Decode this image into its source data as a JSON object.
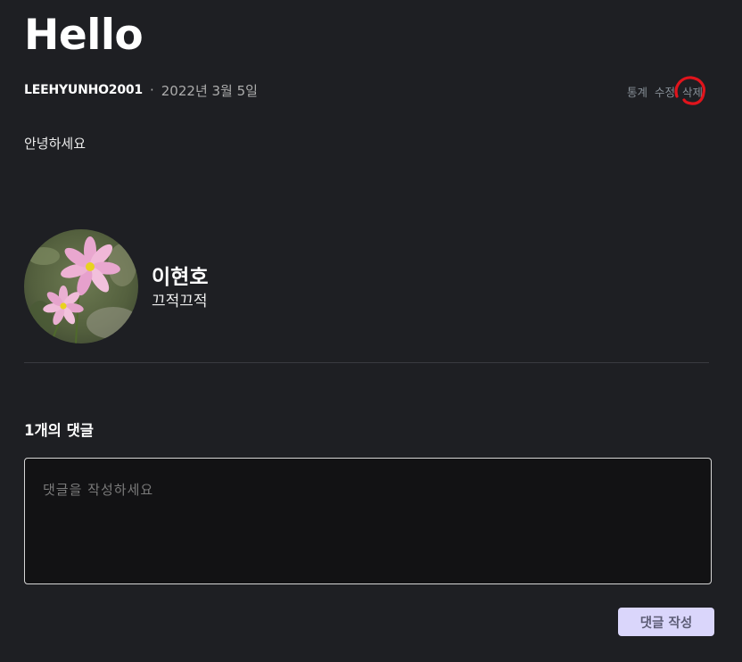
{
  "post": {
    "title": "Hello",
    "author": "LEEHYUNHO2001",
    "separator": "·",
    "date": "2022년 3월 5일",
    "body": "안녕하세요"
  },
  "actions": {
    "stats": "통계",
    "edit": "수정",
    "delete": "삭제"
  },
  "annotation": {
    "color": "#e0141c"
  },
  "profile": {
    "name": "이현호",
    "bio": "끄적끄적"
  },
  "comments": {
    "count_label": "1개의 댓글",
    "placeholder": "댓글을 작성하세요",
    "submit_label": "댓글 작성"
  },
  "colors": {
    "background": "#1e1f23",
    "input_background": "#121214",
    "button_background": "#dad6fb",
    "button_text": "#5d5d76"
  }
}
